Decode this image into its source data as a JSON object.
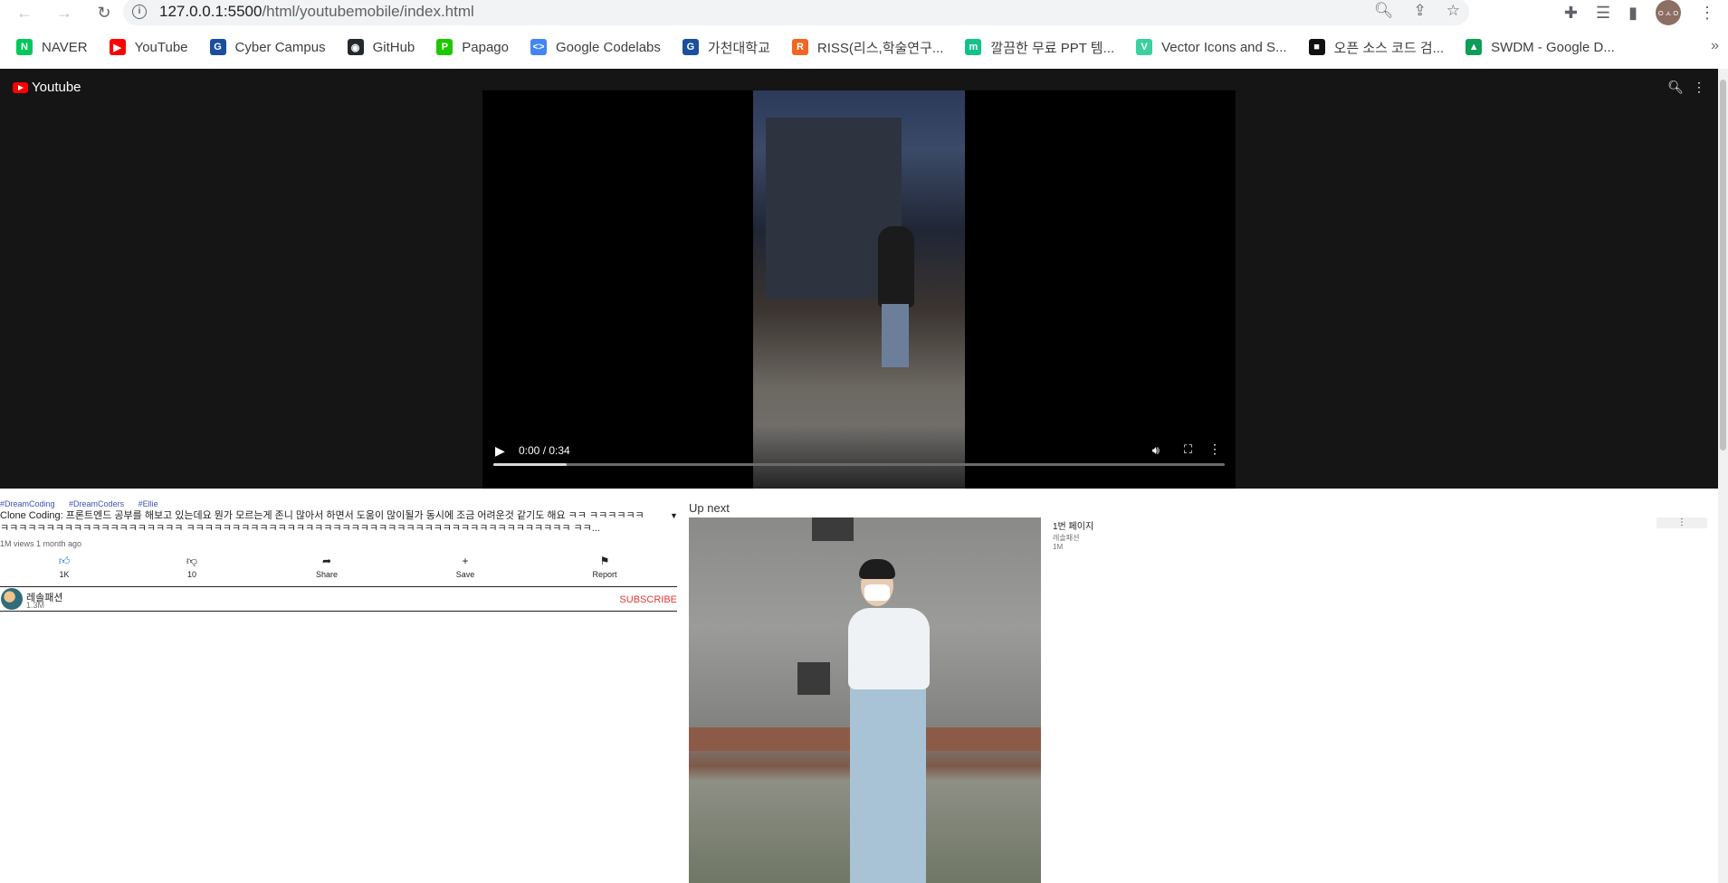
{
  "browser": {
    "url_host": "127.0.0.1:5500",
    "url_path": "/html/youtubemobile/index.html",
    "bookmarks": [
      {
        "label": "NAVER",
        "icon": "naver-icon",
        "color": "#03c75a",
        "glyph": "N"
      },
      {
        "label": "YouTube",
        "icon": "youtube-icon",
        "color": "#ff0000",
        "glyph": "▶"
      },
      {
        "label": "Cyber Campus",
        "icon": "gachon-icon",
        "color": "#1a4fa0",
        "glyph": "G"
      },
      {
        "label": "GitHub",
        "icon": "github-icon",
        "color": "#24292e",
        "glyph": "◉"
      },
      {
        "label": "Papago",
        "icon": "papago-icon",
        "color": "#1ec800",
        "glyph": "P"
      },
      {
        "label": "Google Codelabs",
        "icon": "codelabs-icon",
        "color": "#4285f4",
        "glyph": "<>"
      },
      {
        "label": "가천대학교",
        "icon": "gachon-icon",
        "color": "#1a4fa0",
        "glyph": "G"
      },
      {
        "label": "RISS(리스,학술연구...",
        "icon": "riss-icon",
        "color": "#f26522",
        "glyph": "R"
      },
      {
        "label": "깔끔한 무료 PPT 템...",
        "icon": "miricanvas-icon",
        "color": "#12c28b",
        "glyph": "m"
      },
      {
        "label": "Vector Icons and S...",
        "icon": "flaticon-icon",
        "color": "#3bd0a0",
        "glyph": "V"
      },
      {
        "label": "오픈 소스 코드 검...",
        "icon": "opensource-icon",
        "color": "#111111",
        "glyph": "■"
      },
      {
        "label": "SWDM - Google D...",
        "icon": "google-drive-icon",
        "color": "#0f9d58",
        "glyph": "▲"
      }
    ]
  },
  "header": {
    "logo_text": "Youtube"
  },
  "video": {
    "time": "0:00 / 0:34",
    "progress": 0.1
  },
  "info": {
    "tags": [
      "#DreamCoding",
      "#DreamCoders",
      "#Ellie"
    ],
    "title": "Clone Coding: 프론트엔드 공부를 해보고 있는데요 뭔가 모르는게 존니 많아서 하면서 도움이 많이될가 동시에 조금 어려운것 같기도 해요 ㅋㅋ ㅋㅋㅋㅋㅋㅋㅋㅋㅋㅋㅋㅋㅋㅋㅋㅋㅋㅋㅋㅋㅋㅋㅋㅋㅋㅋ ㅋㅋㅋㅋㅋㅋㅋㅋㅋㅋㅋㅋㅋㅋㅋㅋㅋㅋㅋㅋㅋㅋㅋㅋㅋㅋㅋㅋㅋㅋㅋㅋㅋㅋㅋㅋㅋㅋㅋㅋㅋㅋ ㅋㅋ...",
    "meta": "1M views 1 month ago",
    "actions": {
      "like": "1K",
      "dislike": "10",
      "share": "Share",
      "save": "Save",
      "report": "Report"
    },
    "channel": {
      "name": "레솔패션",
      "subs": "1.3M",
      "subscribe": "SUBSCRIBE"
    }
  },
  "upnext": {
    "label": "Up next",
    "item": {
      "title": "1번 페이지",
      "channel": "레솔패션",
      "views": "1M"
    }
  }
}
